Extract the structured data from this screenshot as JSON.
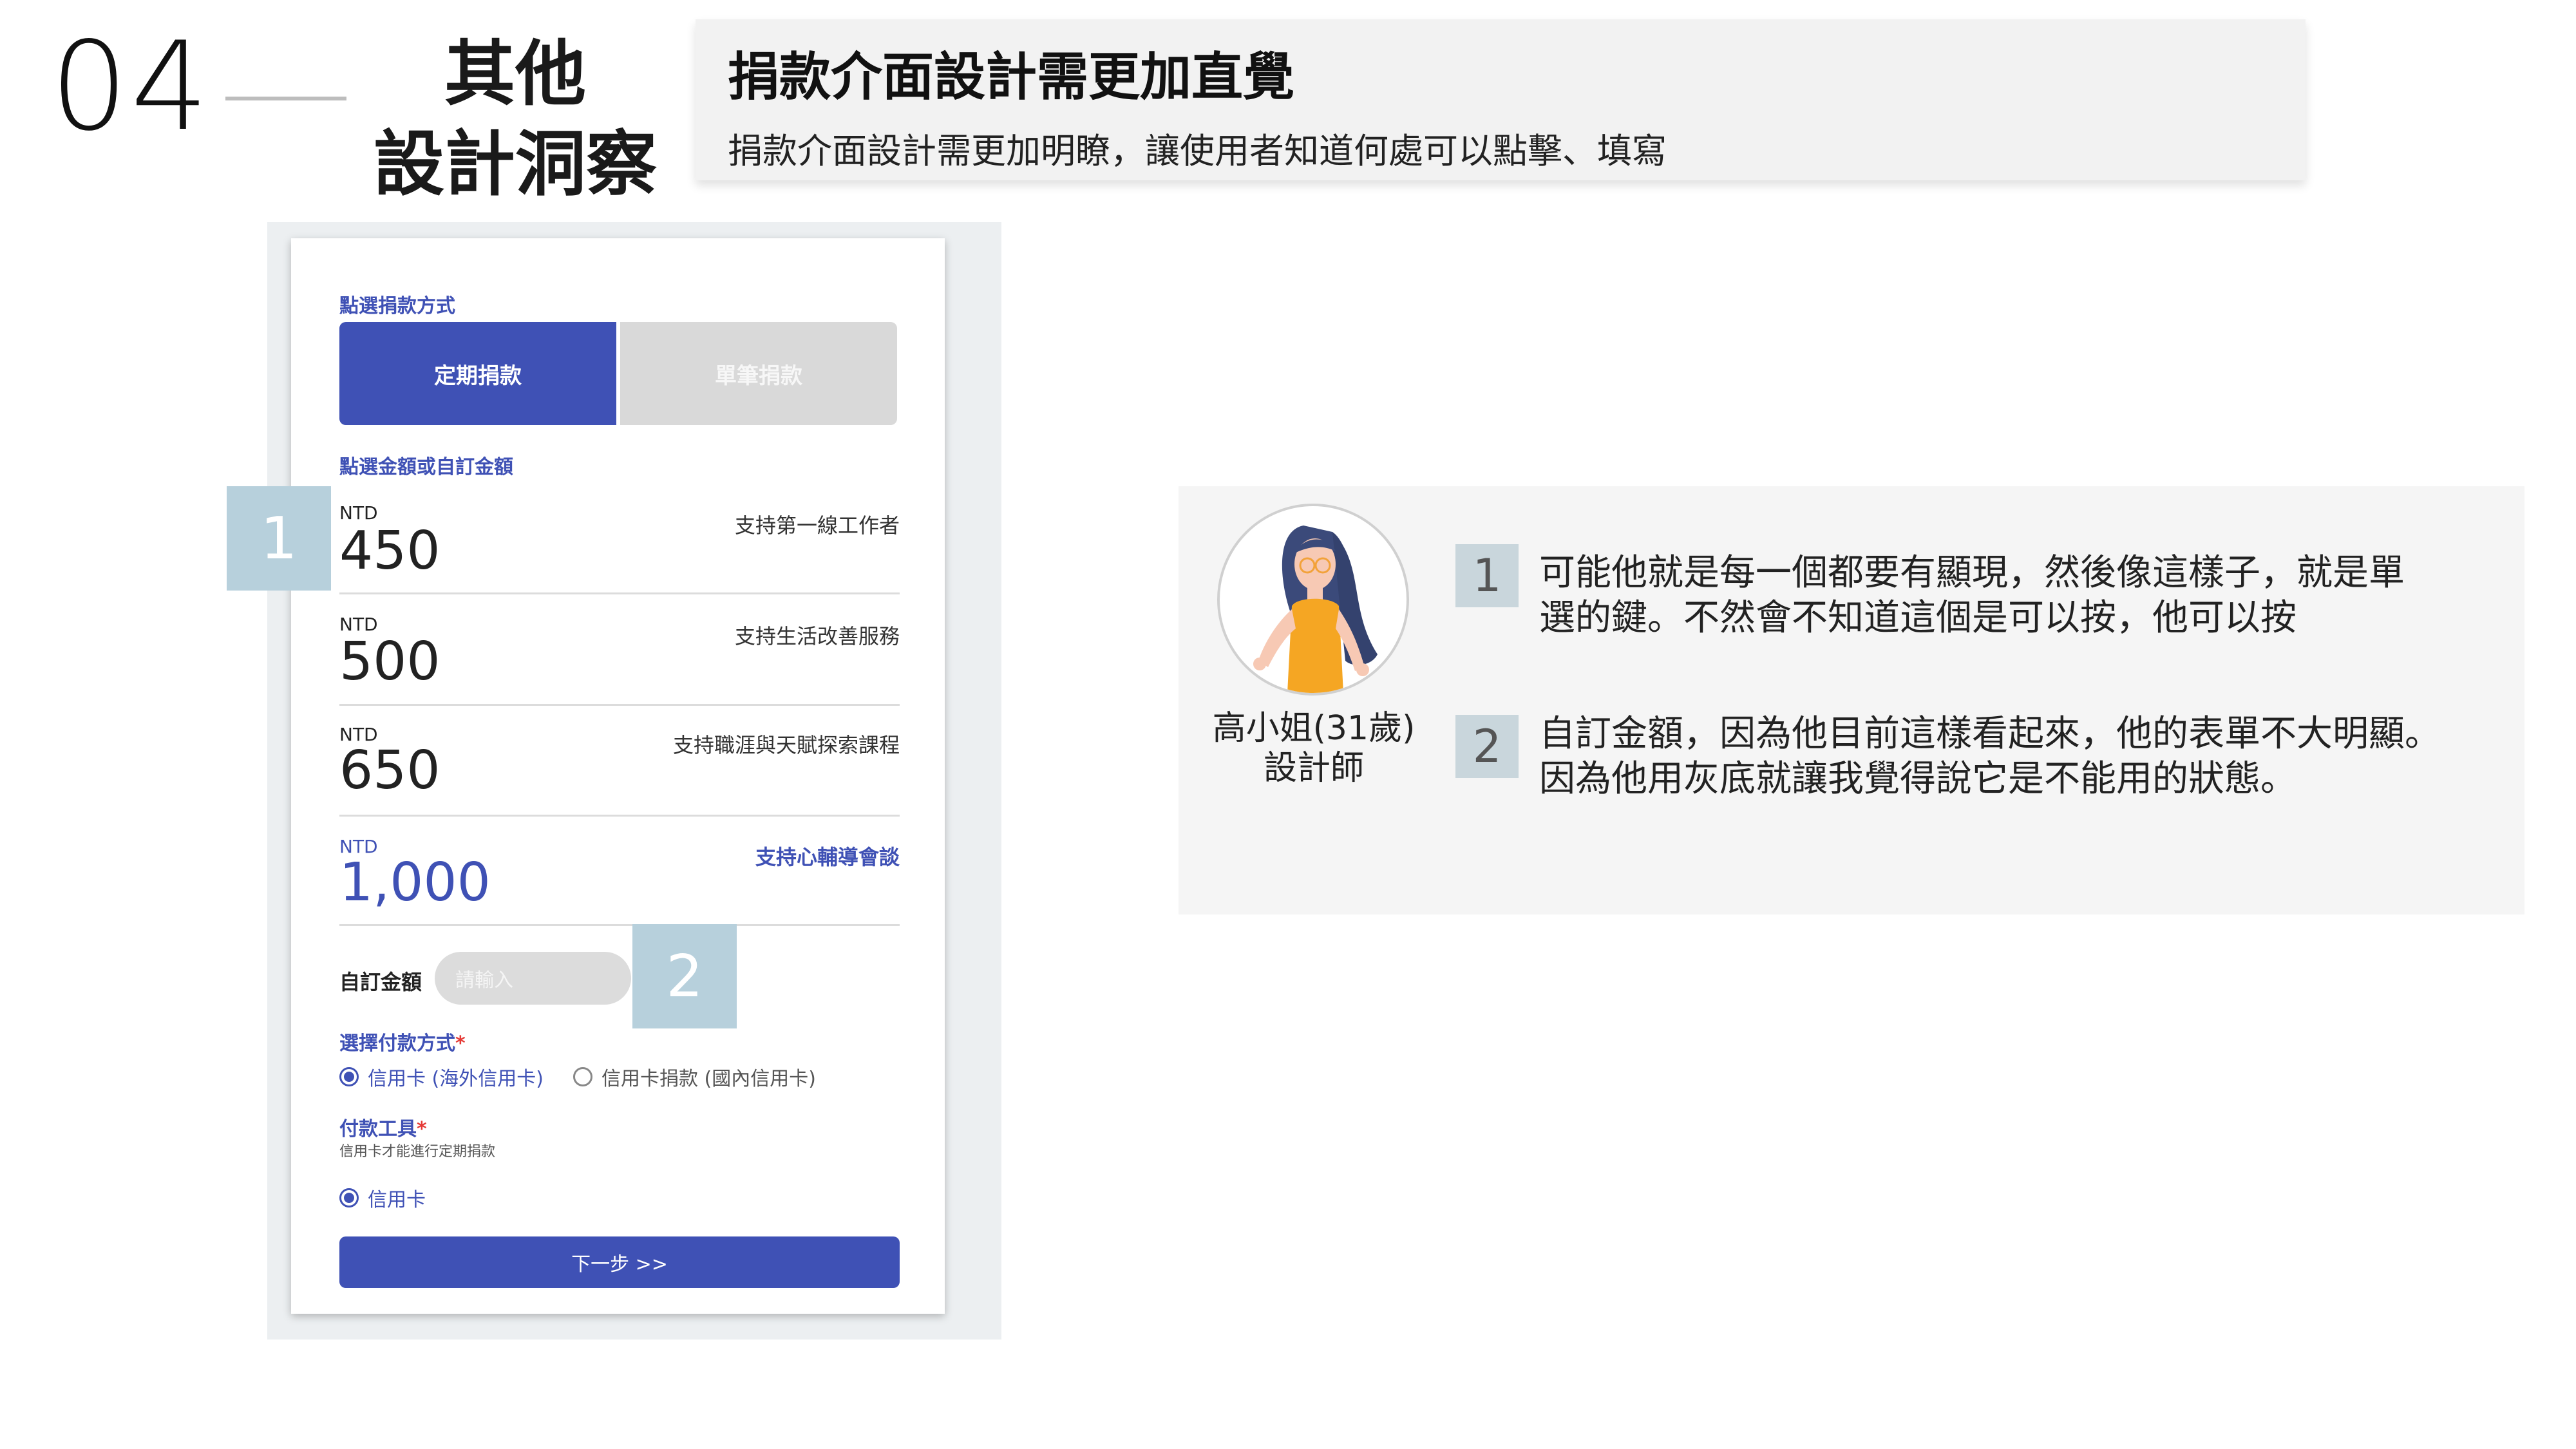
{
  "header": {
    "section_number": "04",
    "section_title_line1": "其他",
    "section_title_line2": "設計洞察",
    "insight_title": "捐款介面設計需更加直覺",
    "insight_subtitle": "捐款介面設計需更加明瞭，讓使用者知道何處可以點擊、填寫"
  },
  "mockup": {
    "method_label": "點選捐款方式",
    "tabs": [
      {
        "label": "定期捐款",
        "active": true
      },
      {
        "label": "單筆捐款",
        "active": false
      }
    ],
    "amount_label": "點選金額或自訂金額",
    "amounts": [
      {
        "currency": "NTD",
        "value": "450",
        "desc": "支持第一線工作者"
      },
      {
        "currency": "NTD",
        "value": "500",
        "desc": "支持生活改善服務"
      },
      {
        "currency": "NTD",
        "value": "650",
        "desc": "支持職涯與天賦探索課程"
      },
      {
        "currency": "NTD",
        "value": "1,000",
        "desc": "支持心輔導會談",
        "selected": true
      }
    ],
    "custom_label": "自訂金額",
    "custom_placeholder": "請輸入",
    "payment_label": "選擇付款方式",
    "payment_required": "*",
    "payment_options": [
      {
        "label": "信用卡 (海外信用卡)",
        "checked": true
      },
      {
        "label": "信用卡捐款 (國內信用卡)",
        "checked": false
      }
    ],
    "tool_label": "付款工具",
    "tool_required": "*",
    "tool_note": "信用卡才能進行定期捐款",
    "tool_option": "信用卡",
    "next_button": "下一步 >>",
    "callouts": [
      "1",
      "2"
    ],
    "accent_color": "#3f51b5"
  },
  "persona": {
    "name": "高小姐(31歲)",
    "role": "設計師",
    "avatar_icon": "woman-avatar-icon",
    "quotes": [
      {
        "num": "1",
        "line1": "可能他就是每一個都要有顯現，然後像這樣子，就是單",
        "line2": "選的鍵。不然會不知道這個是可以按，他可以按"
      },
      {
        "num": "2",
        "line1": "自訂金額，因為他目前這樣看起來，他的表單不大明顯。",
        "line2": "因為他用灰底就讓我覺得說它是不能用的狀態。"
      }
    ]
  }
}
